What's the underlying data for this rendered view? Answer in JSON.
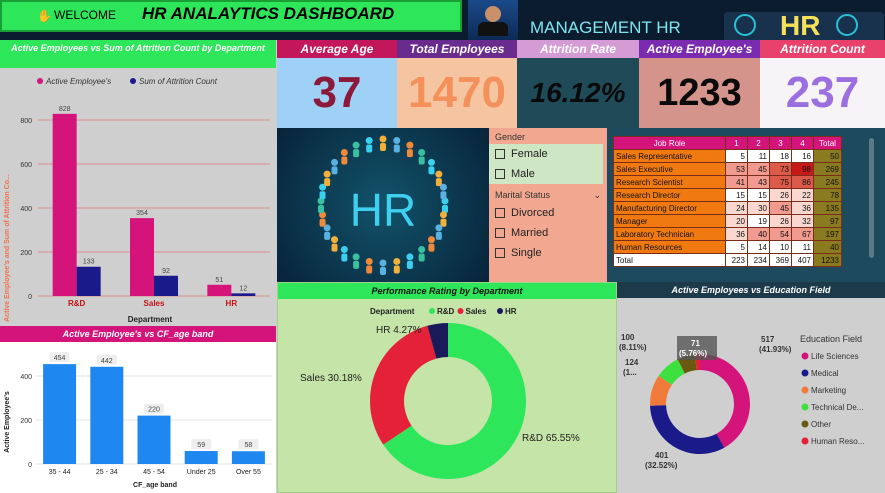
{
  "header": {
    "welcome": "WELCOME",
    "title": "HR ANALAYTICS DASHBOARD",
    "management": "MANAGEMENT  HR",
    "logo": "HR"
  },
  "kpis": [
    {
      "label": "Average Age",
      "value": "37",
      "bg": "#9fd0f5",
      "head": "#c2185b",
      "color": "#8b1a3a"
    },
    {
      "label": "Total Employees",
      "value": "1470",
      "bg": "#f5c4a0",
      "head": "#6a2b8f",
      "color": "#f4915a"
    },
    {
      "label": "Attrition Rate",
      "value": "16.12%",
      "bg": "#1f4a57",
      "head": "#d59bd5",
      "color": "#0a0a0a"
    },
    {
      "label": "Active Employee's",
      "value": "1233",
      "bg": "#d5948b",
      "head": "#7b2bb0",
      "color": "#0a0a0a"
    },
    {
      "label": "Attrition Count",
      "value": "237",
      "bg": "#f7f4f7",
      "head": "#e8416b",
      "color": "#9b6fe0"
    }
  ],
  "dept_chart": {
    "title": "Active Employees vs Sum of Attrition Count by Department",
    "legend": [
      "Active Employee's",
      "Sum of Attrition Count"
    ],
    "xlabel": "Department",
    "ylabel": "Active Employee's and Sum of Attrition Co...",
    "yticks": [
      "0",
      "200",
      "400",
      "600",
      "800"
    ]
  },
  "age_chart": {
    "title": "Active Employee's vs CF_age band",
    "xlabel": "CF_age band",
    "ylabel": "Active Employee's",
    "yticks": [
      "0",
      "200",
      "400"
    ]
  },
  "filters": {
    "gender_label": "Gender",
    "gender": [
      "Female",
      "Male"
    ],
    "marital_label": "Marital Status",
    "marital": [
      "Divorced",
      "Married",
      "Single"
    ]
  },
  "job_table": {
    "headers": [
      "Job Role",
      "1",
      "2",
      "3",
      "4",
      "Total"
    ],
    "rows": [
      [
        "Sales Representative",
        "5",
        "11",
        "18",
        "16",
        "50"
      ],
      [
        "Sales Executive",
        "53",
        "45",
        "73",
        "98",
        "269"
      ],
      [
        "Research Scientist",
        "41",
        "43",
        "75",
        "86",
        "245"
      ],
      [
        "Research Director",
        "15",
        "15",
        "26",
        "22",
        "78"
      ],
      [
        "Manufacturing Director",
        "24",
        "30",
        "45",
        "36",
        "135"
      ],
      [
        "Manager",
        "20",
        "19",
        "26",
        "32",
        "97"
      ],
      [
        "Laboratory Technician",
        "36",
        "40",
        "54",
        "67",
        "197"
      ],
      [
        "Human Resources",
        "5",
        "14",
        "10",
        "11",
        "40"
      ],
      [
        "Total",
        "223",
        "234",
        "369",
        "407",
        "1233"
      ]
    ]
  },
  "perf_chart": {
    "title": "Performance Rating by Department",
    "legend_title": "Department",
    "labels": [
      "R&D 65.55%",
      "Sales 30.18%",
      "HR 4.27%"
    ]
  },
  "edu_chart": {
    "title": "Active Employees vs Education Field",
    "legend_title": "Education Field",
    "legend": [
      "Life Sciences",
      "Medical",
      "Marketing",
      "Technical De...",
      "Other",
      "Human Reso..."
    ],
    "labels": [
      "517",
      "(41.93%)",
      "401",
      "(32.52%)",
      "124",
      "(1...",
      "100",
      "(8.11%)",
      "71",
      "(5.76%)"
    ]
  },
  "chart_data": [
    {
      "type": "bar",
      "title": "Active Employees vs Sum of Attrition Count by Department",
      "categories": [
        "R&D",
        "Sales",
        "HR"
      ],
      "series": [
        {
          "name": "Active Employee's",
          "values": [
            828,
            354,
            51
          ]
        },
        {
          "name": "Sum of Attrition Count",
          "values": [
            133,
            92,
            12
          ]
        }
      ],
      "xlabel": "Department",
      "ylabel": "Active Employee's and Sum of Attrition Co...",
      "ylim": [
        0,
        900
      ],
      "colors": [
        "#d4147b",
        "#1a1a8a"
      ]
    },
    {
      "type": "bar",
      "title": "Active Employee's vs CF_age band",
      "categories": [
        "35 - 44",
        "25 - 34",
        "45 - 54",
        "Under 25",
        "Over 55"
      ],
      "values": [
        454,
        442,
        220,
        59,
        58
      ],
      "xlabel": "CF_age band",
      "ylabel": "Active Employee's",
      "ylim": [
        0,
        500
      ],
      "colors": [
        "#1e88f0"
      ]
    },
    {
      "type": "pie",
      "title": "Performance Rating by Department",
      "categories": [
        "R&D",
        "Sales",
        "HR"
      ],
      "values": [
        65.55,
        30.18,
        4.27
      ],
      "colors": [
        "#2ee65a",
        "#e5213a",
        "#1a1a5a"
      ]
    },
    {
      "type": "pie",
      "title": "Active Employees vs Education Field",
      "categories": [
        "Life Sciences",
        "Medical",
        "Marketing",
        "Technical Degree",
        "Other",
        "Human Resources"
      ],
      "values": [
        517,
        401,
        124,
        100,
        71,
        20
      ],
      "colors": [
        "#d4147b",
        "#1a1a8a",
        "#f07a3a",
        "#3ee040",
        "#6a5a10",
        "#e5213a"
      ]
    }
  ]
}
